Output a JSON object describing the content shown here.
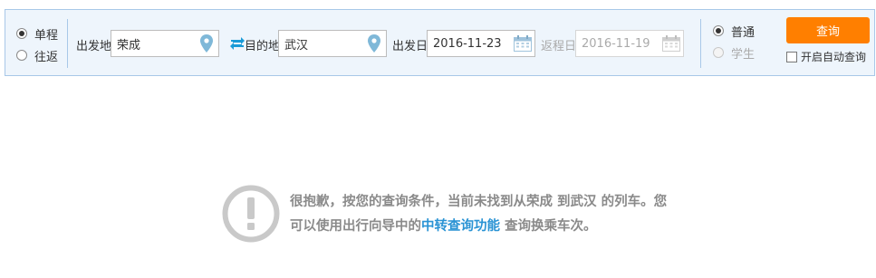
{
  "trip_type": {
    "options": [
      {
        "label": "单程",
        "checked": true
      },
      {
        "label": "往返",
        "checked": false
      }
    ]
  },
  "from": {
    "label": "出发地",
    "value": "荣成"
  },
  "to": {
    "label": "目的地",
    "value": "武汉"
  },
  "depart_date": {
    "label": "出发日",
    "value": "2016-11-23"
  },
  "return_date": {
    "label": "返程日",
    "value": "2016-11-19"
  },
  "passenger_type": {
    "options": [
      {
        "label": "普通",
        "checked": true
      },
      {
        "label": "学生",
        "checked": false,
        "disabled": true
      }
    ]
  },
  "query_button": {
    "label": "查询"
  },
  "auto_query": {
    "label": "开启自动查询",
    "checked": false
  },
  "colors": {
    "accent": "#ff7f00",
    "link": "#2a93d4",
    "icon": "#7fb8d8",
    "panel": "#eef5fc"
  },
  "notice": {
    "text_1": "很抱歉，按您的查询条件，当前未找到从荣成 到武汉 的列车。您可以使用出行向导中的",
    "link": "中转查询功能",
    "text_2": " 查询换乘车次。",
    "icon": "exclamation-circle-icon"
  }
}
